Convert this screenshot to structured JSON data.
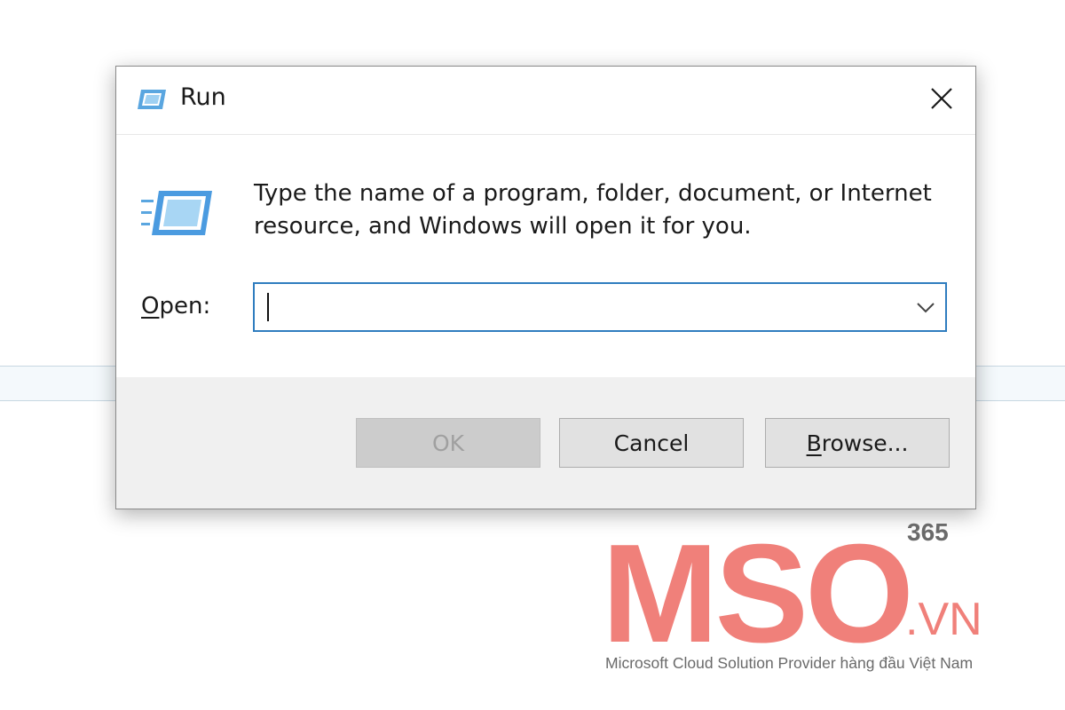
{
  "window": {
    "title": "Run",
    "close_icon": "close-icon",
    "app_icon": "run-icon"
  },
  "dialog": {
    "description": "Type the name of a program, folder, document, or Internet resource, and Windows will open it for you.",
    "open_label_mnemonic": "O",
    "open_label_rest": "pen:",
    "open_value": "",
    "open_placeholder": ""
  },
  "buttons": {
    "ok": "OK",
    "cancel": "Cancel",
    "browse_mnemonic": "B",
    "browse_rest": "rowse..."
  },
  "watermark": {
    "brand": "MSO",
    "superscript": "365",
    "domain": ".VN",
    "caption": "Microsoft Cloud Solution Provider hàng đầu Việt Nam",
    "color": "#f0807a",
    "caption_color": "#6a6a6a"
  },
  "colors": {
    "accent_border": "#2f7dbf",
    "footer_bg": "#f0f0f0",
    "button_bg": "#e1e1e1",
    "button_disabled_bg": "#cccccc"
  }
}
